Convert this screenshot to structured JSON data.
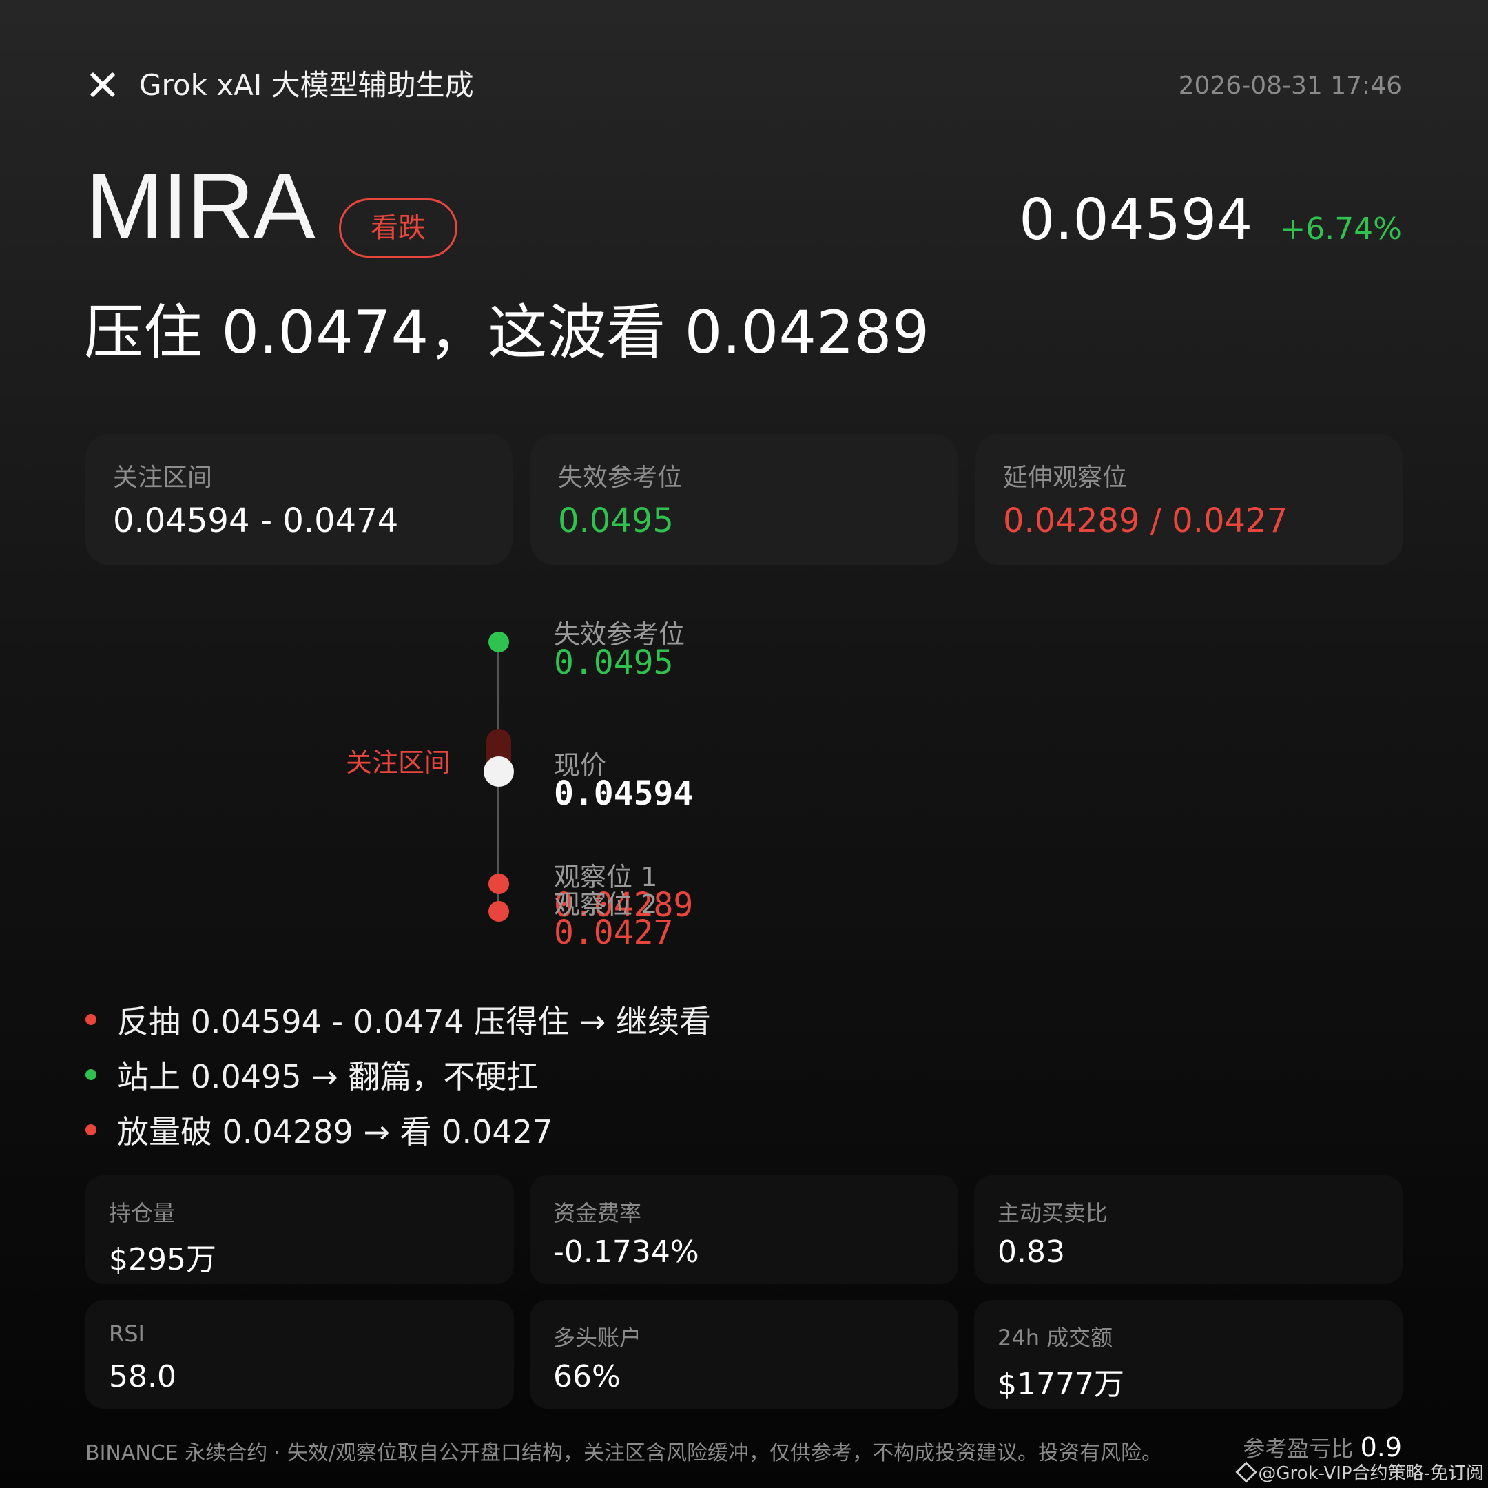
{
  "header": {
    "title": "Grok xAI 大模型辅助生成",
    "timestamp": "2026-08-31 17:46"
  },
  "hero": {
    "symbol": "MIRA",
    "signal": "看跌",
    "price": "0.04594",
    "change": "+6.74%",
    "headline": "压住 0.0474，这波看 0.04289"
  },
  "levels": [
    {
      "label": "关注区间",
      "value": "0.04594 - 0.0474",
      "color": "#ffffff"
    },
    {
      "label": "失效参考位",
      "value": "0.0495",
      "color": "#2fc24f"
    },
    {
      "label": "延伸观察位",
      "value": "0.04289 / 0.0427",
      "color": "#e8453c"
    }
  ],
  "ladder": {
    "zone_label": "关注区间",
    "invalid": {
      "label": "失效参考位",
      "value": "0.0495"
    },
    "current": {
      "label": "现价",
      "value": "0.04594"
    },
    "watch1": {
      "label": "观察位 1",
      "value": "0.04289"
    },
    "watch2": {
      "label": "观察位 2",
      "value": "0.0427"
    }
  },
  "bullets": [
    {
      "text": "反抽 0.04594 - 0.0474 压得住 → 继续看",
      "color": "#e8453c"
    },
    {
      "text": "站上 0.0495 → 翻篇，不硬扛",
      "color": "#2fc24f"
    },
    {
      "text": "放量破 0.04289 → 看 0.0427",
      "color": "#e8453c"
    }
  ],
  "stats": [
    {
      "label": "持仓量",
      "value": "$295万"
    },
    {
      "label": "资金费率",
      "value": "-0.1734%"
    },
    {
      "label": "主动买卖比",
      "value": "0.83"
    },
    {
      "label": "RSI",
      "value": "58.0"
    },
    {
      "label": "多头账户",
      "value": "66%"
    },
    {
      "label": "24h 成交额",
      "value": "$1777万"
    }
  ],
  "footer": {
    "disclaimer": "BINANCE 永续合约 · 失效/观察位取自公开盘口结构，关注区含风险缓冲，仅供参考，不构成投资建议。投资有风险。",
    "ratio_label": "参考盈亏比",
    "ratio_value": "0.9",
    "watermark": "@Grok-VIP合约策略-免订阅"
  },
  "colors": {
    "bearish": "#e8453c",
    "bullish": "#2fc24f"
  }
}
